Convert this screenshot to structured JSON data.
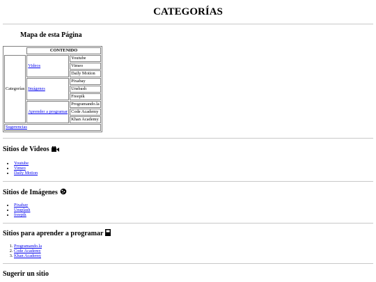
{
  "page_title": "CATEGORÍAS",
  "site_map": {
    "title": "Mapa de esta Página",
    "header": "CONTENIDO",
    "root_label": "Categorías",
    "groups": [
      {
        "label": "Videos",
        "items": [
          "Youtube",
          "Vimeo",
          "Daily Motion"
        ]
      },
      {
        "label": "Imágenes",
        "items": [
          "Pixabay",
          "Unsbash",
          "Freepik"
        ]
      },
      {
        "label": "Aprender a programar",
        "items": [
          "Programando.la",
          "Code Academy",
          "Khan Academy"
        ]
      }
    ],
    "suggest_link": "Sugerencias"
  },
  "sections": {
    "videos": {
      "title": "Sitios de Videos",
      "icon": "video-camera-icon",
      "items": [
        "Youtube",
        "Vimeo",
        "Daily Motion"
      ]
    },
    "images": {
      "title": "Sitios de Imágenes",
      "icon": "image-icon",
      "items": [
        "Pixabay",
        "Unsplash",
        "freepik"
      ]
    },
    "programming": {
      "title": "Sitios para aprender a programar",
      "icon": "book-icon",
      "items": [
        "Programando.la",
        "Code Academy",
        "Khan Academy"
      ]
    },
    "suggest": {
      "title": "Sugerir un sitio"
    }
  },
  "colors": {
    "link": "#0000ee",
    "divider": "#c8c8c8",
    "table_border": "#808080"
  }
}
